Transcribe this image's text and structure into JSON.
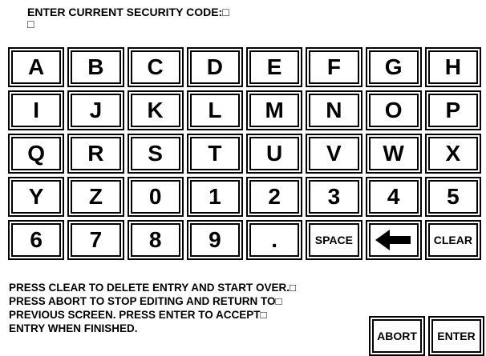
{
  "prompt": {
    "title": "ENTER CURRENT SECURITY CODE:□",
    "entry": "□"
  },
  "keys": [
    "A",
    "B",
    "C",
    "D",
    "E",
    "F",
    "G",
    "H",
    "I",
    "J",
    "K",
    "L",
    "M",
    "N",
    "O",
    "P",
    "Q",
    "R",
    "S",
    "T",
    "U",
    "V",
    "W",
    "X",
    "Y",
    "Z",
    "0",
    "1",
    "2",
    "3",
    "4",
    "5",
    "6",
    "7",
    "8",
    "9",
    ".",
    "SPACE",
    "backspace-arrow-icon",
    "CLEAR"
  ],
  "help_lines": [
    "PRESS CLEAR TO DELETE ENTRY AND START OVER.□",
    "PRESS ABORT TO STOP EDITING AND RETURN TO□",
    "PREVIOUS SCREEN. PRESS ENTER TO ACCEPT□",
    "ENTRY WHEN FINISHED."
  ],
  "buttons": {
    "abort": "ABORT",
    "enter": "ENTER"
  }
}
